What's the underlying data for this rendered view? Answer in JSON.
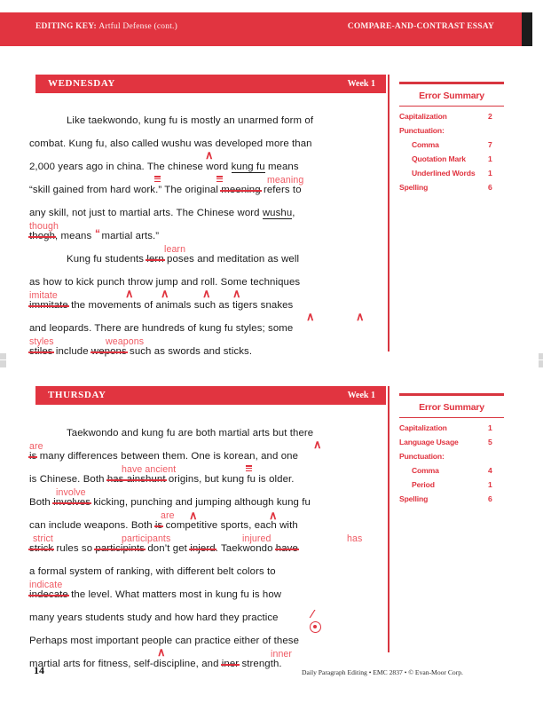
{
  "header": {
    "left_label": "EDITING KEY:",
    "left_title": "Artful Defense (cont.)",
    "right_title": "COMPARE-AND-CONTRAST ESSAY"
  },
  "footer": {
    "page_number": "14",
    "credit": "Daily Paragraph Editing • EMC 2837 • © Evan-Moor Corp."
  },
  "colors": {
    "brand_red": "#e13440",
    "mark_red": "#e0333f",
    "correction_pink": "#ef5a63"
  },
  "sections": [
    {
      "day": "WEDNESDAY",
      "week": "Week 1",
      "error_summary": {
        "title": "Error Summary",
        "rows": [
          {
            "label": "Capitalization",
            "count": "2",
            "indent": false
          },
          {
            "label": "Punctuation:",
            "count": "",
            "indent": false
          },
          {
            "label": "Comma",
            "count": "7",
            "indent": true
          },
          {
            "label": "Quotation Mark",
            "count": "1",
            "indent": true
          },
          {
            "label": "Underlined Words",
            "count": "1",
            "indent": true
          },
          {
            "label": "Spelling",
            "count": "6",
            "indent": false
          }
        ]
      },
      "lines": [
        "Like taekwondo, kung fu is mostly an unarmed form of",
        "combat. Kung fu, also called wushu was developed more than",
        "2,000 years ago in china. The chinese word kung fu means",
        "“skill gained from hard work.” The original meening refers to",
        "any skill, not just to martial arts. The Chinese word wushu,",
        "thogh, means “martial arts.”",
        "Kung fu students lern poses and meditation as well",
        "as how to kick punch throw jump and roll. Some techniques",
        "immitate the movements of animals such as tigers snakes",
        "and leopards. There are hundreds of kung fu styles; some",
        "stiles include wepons such as swords and sticks."
      ],
      "corrections": [
        "meaning",
        "though",
        "learn",
        "imitate",
        "styles",
        "weapons"
      ]
    },
    {
      "day": "THURSDAY",
      "week": "Week 1",
      "error_summary": {
        "title": "Error Summary",
        "rows": [
          {
            "label": "Capitalization",
            "count": "1",
            "indent": false
          },
          {
            "label": "Language Usage",
            "count": "5",
            "indent": false
          },
          {
            "label": "Punctuation:",
            "count": "",
            "indent": false
          },
          {
            "label": "Comma",
            "count": "4",
            "indent": true
          },
          {
            "label": "Period",
            "count": "1",
            "indent": true
          },
          {
            "label": "Spelling",
            "count": "6",
            "indent": false
          }
        ]
      },
      "lines": [
        "Taekwondo and kung fu are both martial arts but there",
        "is many differences between them. One is korean, and one",
        "is Chinese. Both has ainshunt origins, but kung fu is older.",
        "Both involves kicking, punching and jumping although kung fu",
        "can include weapons. Both is competitive sports, each with",
        "strick rules so participints don’t get injerd. Taekwondo have",
        "a formal system of ranking, with different belt colors to",
        "indecate the level. What matters most in kung fu is how",
        "many years students study and how hard they practice",
        "Perhaps most important people can practice either of these",
        "martial arts for fitness, self-discipline, and iner strength."
      ],
      "corrections": [
        "are",
        "have ancient",
        "involve",
        "are",
        "strict",
        "participants",
        "injured",
        "has",
        "indicate",
        "inner"
      ]
    }
  ],
  "wednesday_text": {
    "l1_a": "Like taekwondo, kung fu is mostly an unarmed form of",
    "l2_a": "combat. Kung fu, also called wushu",
    "l2_b": "was developed more than",
    "l3_a": "2,000 years ago in china. The chinese word",
    "l3_b": "kung fu",
    "l3_c": "means",
    "l4_a": "“skill gained from hard work.” The original",
    "l4_strike": "meening",
    "l4_corr": "meaning",
    "l4_b": "refers to",
    "l5_a": "any skill, not just to martial arts. The Chinese word",
    "l5_b": "wushu",
    "l5_c": ",",
    "l6_strike": "thogh",
    "l6_corr": "though",
    "l6_a": ", means",
    "l6_b": "martial arts.”",
    "l7_a": "Kung fu students",
    "l7_strike": "lern",
    "l7_corr": "learn",
    "l7_b": "poses and meditation as well",
    "l8_a": "as how to kick punch throw jump and roll. Some techniques",
    "l9_strike": "immitate",
    "l9_corr": "imitate",
    "l9_a": "the movements of animals such as tigers snakes",
    "l10_a": "and leopards. There are hundreds of kung fu styles; some",
    "l11_strike": "stiles",
    "l11_corr": "styles",
    "l11_a": "include",
    "l11_strike2": "wepons",
    "l11_corr2": "weapons",
    "l11_b": "such as swords and sticks."
  },
  "thursday_text": {
    "l1_a": "Taekwondo and kung fu are both martial arts",
    "l1_b": "but there",
    "l2_strike": "is",
    "l2_corr": "are",
    "l2_a": "many differences between them. One is korean, and one",
    "l3_a": "is Chinese. Both",
    "l3_strike": "has ainshunt",
    "l3_corr": "have ancient",
    "l3_b": "origins, but kung fu is older.",
    "l4_a": "Both",
    "l4_strike": "involves",
    "l4_corr": "involve",
    "l4_b": "kicking, punching and jumping although kung fu",
    "l5_a": "can include weapons. Both",
    "l5_strike": "is",
    "l5_corr": "are",
    "l5_b": "competitive sports, each with",
    "l6_strike": "strick",
    "l6_corr": "strict",
    "l6_a": "rules so",
    "l6_strike2": "participints",
    "l6_corr2": "participants",
    "l6_b": "don’t get",
    "l6_strike3": "injerd",
    "l6_corr3": "injured",
    "l6_c": ". Taekwondo",
    "l6_strike4": "have",
    "l6_corr4": "has",
    "l7_a": "a formal system of ranking, with different belt colors to",
    "l8_strike": "indecate",
    "l8_corr": "indicate",
    "l8_a": "the level. What matters most in kung fu is how",
    "l9_a": "many years students study and how hard they practice",
    "l10_a": "Perhaps most important people can practice either of these",
    "l11_a": "martial arts for fitness, self-discipline, and",
    "l11_strike": "iner",
    "l11_corr": "inner",
    "l11_b": "strength."
  }
}
